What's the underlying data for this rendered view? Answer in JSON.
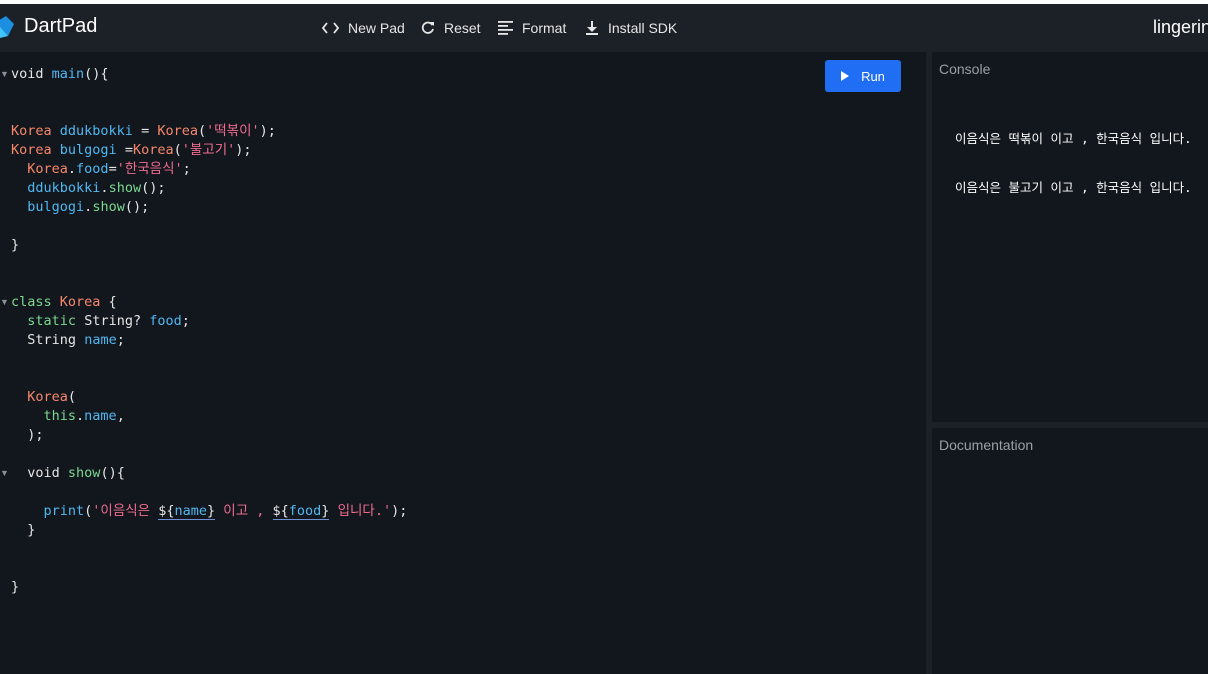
{
  "header": {
    "app_title": "DartPad",
    "pad_title": "lingerin",
    "toolbar": {
      "new_pad": "New Pad",
      "reset": "Reset",
      "format": "Format",
      "install_sdk": "Install SDK"
    },
    "icons": [
      "dart-logo-icon",
      "code-icon",
      "refresh-icon",
      "format-icon",
      "download-icon"
    ]
  },
  "editor": {
    "run_label": "Run",
    "lines": [
      "void main(){",
      "",
      "",
      "Korea ddukbokki = Korea('떡볶이');",
      "Korea bulgogi =Korea('불고기');",
      "  Korea.food='한국음식';",
      "  ddukbokki.show();",
      "  bulgogi.show();",
      "",
      "}",
      "",
      "",
      "class Korea {",
      "  static String? food;",
      "  String name;",
      "",
      "",
      "  Korea(",
      "    this.name,",
      "  );",
      "",
      "  void show(){",
      "",
      "    print('이음식은 ${name} 이고 , ${food} 입니다.');",
      "  }",
      "",
      "",
      "}"
    ]
  },
  "console": {
    "title": "Console",
    "output": [
      "이음식은 떡볶이 이고 , 한국음식 입니다.",
      "이음식은 불고기 이고 , 한국음식 입니다."
    ]
  },
  "documentation": {
    "title": "Documentation"
  },
  "colors": {
    "background": "#12161d",
    "header": "#1c2027",
    "run_button": "#1f6ef3",
    "keyword": "#50b8f0",
    "type": "#f7876b",
    "string": "#f06c8f",
    "function": "#7bd88f"
  }
}
